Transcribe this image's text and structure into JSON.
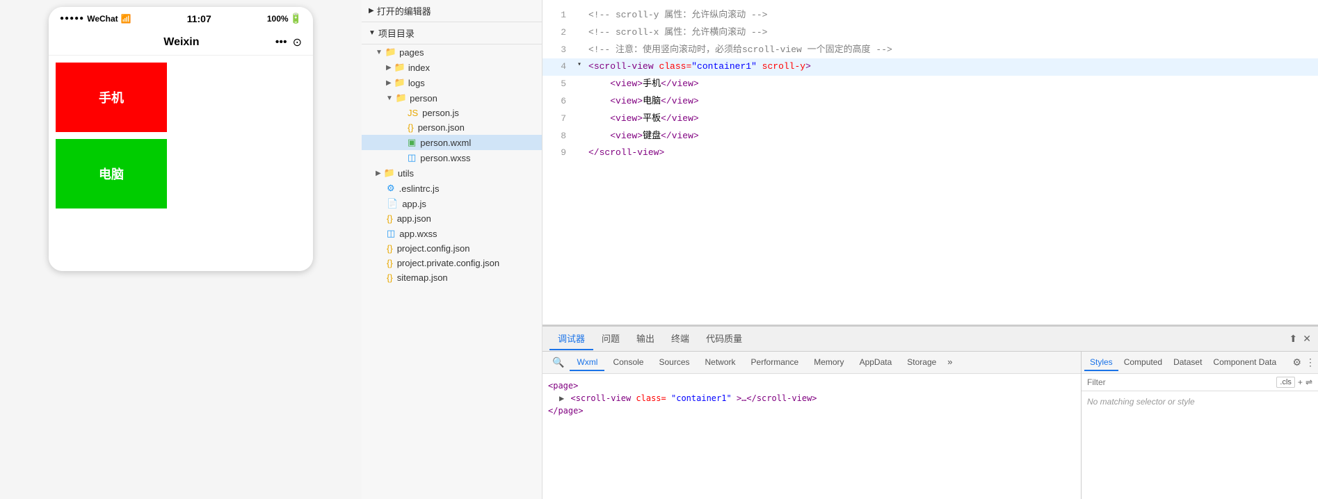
{
  "phone": {
    "status": {
      "dots": "●●●●●",
      "carrier": "WeChat",
      "wifi": "☞",
      "time": "11:07",
      "battery_pct": "100%",
      "battery_icon": "▓"
    },
    "title": "Weixin",
    "header_icons": {
      "dots": "•••",
      "circle": "⊙"
    },
    "boxes": [
      {
        "label": "手机",
        "color": "#ff0000"
      },
      {
        "label": "电脑",
        "color": "#00cc00"
      }
    ]
  },
  "file_tree": {
    "opened_editors_label": "打开的编辑器",
    "project_label": "项目目录",
    "items": [
      {
        "indent": 1,
        "arrow": "▼",
        "icon": "📁",
        "label": "pages",
        "type": "folder"
      },
      {
        "indent": 2,
        "arrow": "▶",
        "icon": "📁",
        "label": "index",
        "type": "folder"
      },
      {
        "indent": 2,
        "arrow": "▶",
        "icon": "📁",
        "label": "logs",
        "type": "folder"
      },
      {
        "indent": 2,
        "arrow": "▼",
        "icon": "📁",
        "label": "person",
        "type": "folder"
      },
      {
        "indent": 3,
        "arrow": "",
        "icon": "📄",
        "label": "person.js",
        "type": "js"
      },
      {
        "indent": 3,
        "arrow": "",
        "icon": "📋",
        "label": "person.json",
        "type": "json"
      },
      {
        "indent": 3,
        "arrow": "",
        "icon": "🟩",
        "label": "person.wxml",
        "type": "wxml",
        "selected": true
      },
      {
        "indent": 3,
        "arrow": "",
        "icon": "🎨",
        "label": "person.wxss",
        "type": "wxss"
      },
      {
        "indent": 1,
        "arrow": "▶",
        "icon": "📁",
        "label": "utils",
        "type": "folder"
      },
      {
        "indent": 1,
        "arrow": "",
        "icon": "⚙️",
        "label": ".eslintrc.js",
        "type": "js"
      },
      {
        "indent": 1,
        "arrow": "",
        "icon": "📄",
        "label": "app.js",
        "type": "js"
      },
      {
        "indent": 1,
        "arrow": "",
        "icon": "📋",
        "label": "app.json",
        "type": "json"
      },
      {
        "indent": 1,
        "arrow": "",
        "icon": "🎨",
        "label": "app.wxss",
        "type": "wxss"
      },
      {
        "indent": 1,
        "arrow": "",
        "icon": "📋",
        "label": "project.config.json",
        "type": "json"
      },
      {
        "indent": 1,
        "arrow": "",
        "icon": "📋",
        "label": "project.private.config.json",
        "type": "json"
      },
      {
        "indent": 1,
        "arrow": "",
        "icon": "📋",
        "label": "sitemap.json",
        "type": "json"
      }
    ]
  },
  "code": {
    "lines": [
      {
        "num": 1,
        "arrow": "",
        "content": "<!-- scroll-y 属性：允许纵向滚动 -->",
        "type": "comment"
      },
      {
        "num": 2,
        "arrow": "",
        "content": "<!-- scroll-x 属性：允许横向滚动 -->",
        "type": "comment"
      },
      {
        "num": 3,
        "arrow": "",
        "content": "<!-- 注意：使用竖向滚动时，必须给scroll-view 一个固定的高度 -->",
        "type": "comment"
      },
      {
        "num": 4,
        "arrow": "▾",
        "content_parts": [
          {
            "text": "<",
            "cls": "tag-bracket"
          },
          {
            "text": "scroll-view",
            "cls": "tag"
          },
          {
            "text": " class=",
            "cls": "attr"
          },
          {
            "text": "\"container1\"",
            "cls": "attr-val"
          },
          {
            "text": " scroll-y",
            "cls": "attr"
          },
          {
            "text": ">",
            "cls": "tag-bracket"
          }
        ],
        "type": "tag",
        "highlight": true
      },
      {
        "num": 5,
        "arrow": "",
        "content_parts": [
          {
            "text": "  <",
            "cls": "tag-bracket"
          },
          {
            "text": "view",
            "cls": "tag"
          },
          {
            "text": ">手机</",
            "cls": "text-content"
          },
          {
            "text": "view",
            "cls": "tag"
          },
          {
            "text": ">",
            "cls": "tag-bracket"
          }
        ],
        "type": "tag"
      },
      {
        "num": 6,
        "arrow": "",
        "content_parts": [
          {
            "text": "  <",
            "cls": "tag-bracket"
          },
          {
            "text": "view",
            "cls": "tag"
          },
          {
            "text": ">电脑</",
            "cls": "text-content"
          },
          {
            "text": "view",
            "cls": "tag"
          },
          {
            "text": ">",
            "cls": "tag-bracket"
          }
        ],
        "type": "tag"
      },
      {
        "num": 7,
        "arrow": "",
        "content_parts": [
          {
            "text": "  <",
            "cls": "tag-bracket"
          },
          {
            "text": "view",
            "cls": "tag"
          },
          {
            "text": ">平板</",
            "cls": "text-content"
          },
          {
            "text": "view",
            "cls": "tag"
          },
          {
            "text": ">",
            "cls": "tag-bracket"
          }
        ],
        "type": "tag"
      },
      {
        "num": 8,
        "arrow": "",
        "content_parts": [
          {
            "text": "  <",
            "cls": "tag-bracket"
          },
          {
            "text": "view",
            "cls": "tag"
          },
          {
            "text": ">键盘</",
            "cls": "text-content"
          },
          {
            "text": "view",
            "cls": "tag"
          },
          {
            "text": ">",
            "cls": "tag-bracket"
          }
        ],
        "type": "tag"
      },
      {
        "num": 9,
        "arrow": "",
        "content_parts": [
          {
            "text": "</",
            "cls": "tag-bracket"
          },
          {
            "text": "scroll-view",
            "cls": "tag"
          },
          {
            "text": ">",
            "cls": "tag-bracket"
          }
        ],
        "type": "tag"
      }
    ]
  },
  "devtools": {
    "top_tabs": [
      {
        "label": "调试器",
        "active": true
      },
      {
        "label": "问题"
      },
      {
        "label": "输出"
      },
      {
        "label": "终端"
      },
      {
        "label": "代码质量"
      }
    ],
    "bottom_tabs": [
      {
        "label": "Wxml",
        "active": true
      },
      {
        "label": "Console"
      },
      {
        "label": "Sources"
      },
      {
        "label": "Network"
      },
      {
        "label": "Performance"
      },
      {
        "label": "Memory"
      },
      {
        "label": "AppData"
      },
      {
        "label": "Storage"
      },
      {
        "label": "»"
      }
    ],
    "dom_content": [
      {
        "text": "<page>",
        "indent": 0
      },
      {
        "text": "▶ <scroll-view class=\"container1\">…</scroll-view>",
        "indent": 1,
        "expanded": true
      },
      {
        "text": "</page>",
        "indent": 0
      }
    ],
    "right_tabs": [
      {
        "label": "Styles",
        "active": true
      },
      {
        "label": "Computed"
      },
      {
        "label": "Dataset"
      },
      {
        "label": "Component Data"
      }
    ],
    "filter_placeholder": "Filter",
    "filter_cls_label": ".cls",
    "styles_empty_text": "No matching selector or style"
  }
}
